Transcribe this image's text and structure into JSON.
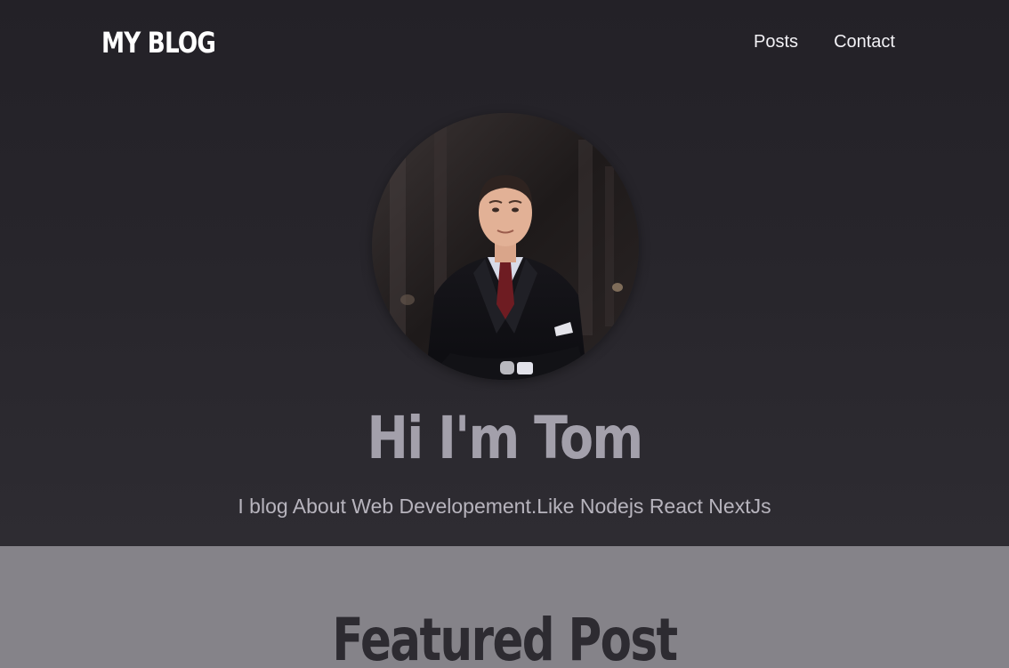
{
  "header": {
    "logo_text": "MY BLOG",
    "nav_items": [
      {
        "label": "Posts"
      },
      {
        "label": "Contact"
      }
    ]
  },
  "hero": {
    "avatar_alt": "Portrait of a man in a suit",
    "title": "Hi I'm Tom",
    "subtitle": "I blog About Web Developement.Like Nodejs React NextJs"
  },
  "featured": {
    "title": "Featured Post"
  },
  "colors": {
    "header_bg": "#232127",
    "hero_title": "#a3a0ab",
    "hero_subtitle": "#b7b4bd",
    "featured_bg": "#858389",
    "featured_title": "#2d2b31"
  },
  "icons": {
    "avatar": "profile-photo"
  }
}
